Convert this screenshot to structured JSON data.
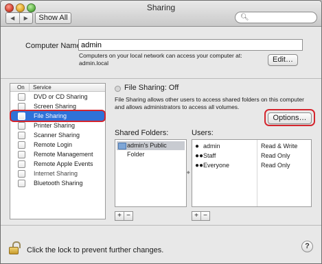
{
  "window": {
    "title": "Sharing"
  },
  "toolbar": {
    "back": "◀",
    "forward": "▶",
    "show_all": "Show All",
    "search_placeholder": ""
  },
  "computer_name": {
    "label": "Computer Name:",
    "value": "admin",
    "desc_line1": "Computers on your local network can access your computer at:",
    "desc_line2": "admin.local",
    "edit_label": "Edit…"
  },
  "services": {
    "header_on": "On",
    "header_service": "Service",
    "items": [
      {
        "label": "DVD or CD Sharing",
        "checked": false
      },
      {
        "label": "Screen Sharing",
        "checked": false
      },
      {
        "label": "File Sharing",
        "checked": false,
        "selected": true
      },
      {
        "label": "Printer Sharing",
        "checked": false
      },
      {
        "label": "Scanner Sharing",
        "checked": false
      },
      {
        "label": "Remote Login",
        "checked": false
      },
      {
        "label": "Remote Management",
        "checked": false
      },
      {
        "label": "Remote Apple Events",
        "checked": false
      },
      {
        "label": "Internet Sharing",
        "checked": false,
        "disabled": true
      },
      {
        "label": "Bluetooth Sharing",
        "checked": false
      }
    ]
  },
  "status": {
    "text": "File Sharing: Off",
    "desc_line1": "File Sharing allows other users to access shared folders on this computer",
    "desc_line2": "and allows administrators to access all volumes.",
    "options_label": "Options…"
  },
  "shared_folders": {
    "label": "Shared Folders:",
    "items": [
      "admin's Public Folder"
    ]
  },
  "users": {
    "label": "Users:",
    "items": [
      {
        "name": "admin",
        "privilege": "Read & Write",
        "icon": "single-user-icon"
      },
      {
        "name": "Staff",
        "privilege": "Read Only",
        "icon": "group-icon"
      },
      {
        "name": "Everyone",
        "privilege": "Read Only",
        "icon": "group-icon"
      }
    ]
  },
  "buttons": {
    "add": "+",
    "remove": "−"
  },
  "footer": {
    "lock_text": "Click the lock to prevent further changes.",
    "help": "?"
  },
  "colors": {
    "highlight": "#d4252d",
    "selection": "#2f72d8"
  }
}
